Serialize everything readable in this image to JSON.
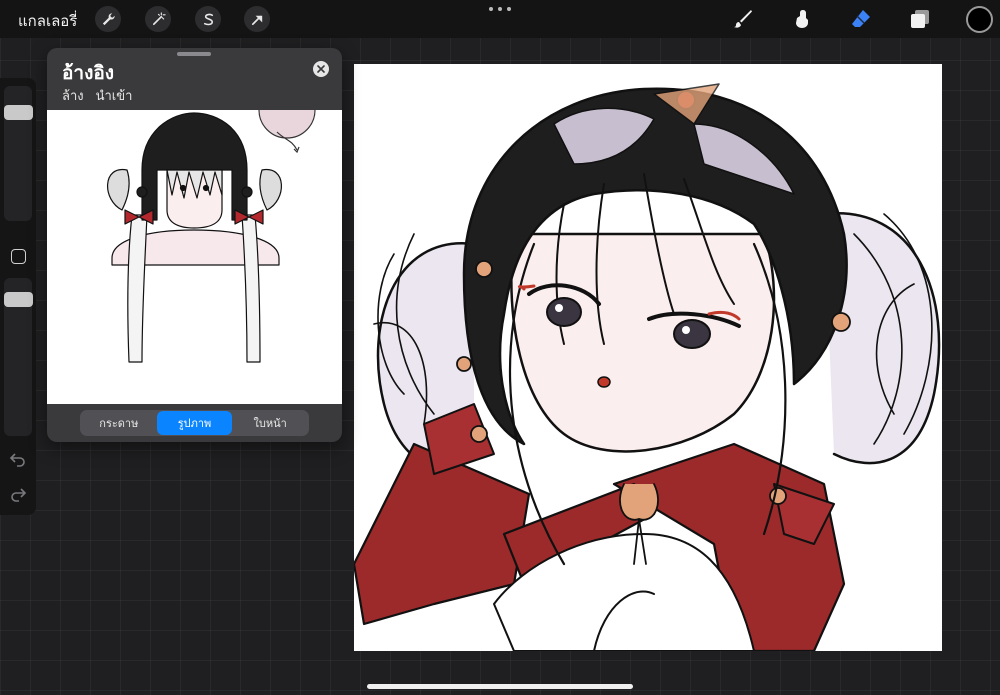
{
  "topbar": {
    "gallery_label": "แกลเลอรี่",
    "actions": [
      {
        "name": "actions-wrench",
        "icon": "wrench-icon"
      },
      {
        "name": "adjustments-wand",
        "icon": "magic-wand-icon"
      },
      {
        "name": "selection",
        "icon": "selection-s-icon"
      },
      {
        "name": "transform",
        "icon": "arrow-cursor-icon"
      }
    ],
    "tools": [
      {
        "name": "brush",
        "icon": "brush-icon",
        "active": false
      },
      {
        "name": "smudge",
        "icon": "smudge-finger-icon",
        "active": false
      },
      {
        "name": "eraser",
        "icon": "eraser-icon",
        "active": true
      },
      {
        "name": "layers",
        "icon": "layers-icon",
        "active": false
      }
    ],
    "current_color": "#000000",
    "accent_color": "#3b82f6"
  },
  "sidebar": {
    "brush_size": 0.1,
    "brush_opacity": 0.2
  },
  "reference": {
    "title": "อ้างอิง",
    "clear_label": "ล้าง",
    "import_label": "นำเข้า",
    "segments": [
      "กระดาษ",
      "รูปภาพ",
      "ใบหน้า"
    ],
    "active_segment": 1,
    "active_color": "#0a84ff"
  },
  "palette": {
    "hair": "#1e1e1e",
    "hair_highlight": "#c7bfcf",
    "ribbon": "#9c2a2b",
    "skin": "#fbeeee",
    "accent": "#e2a37a"
  }
}
